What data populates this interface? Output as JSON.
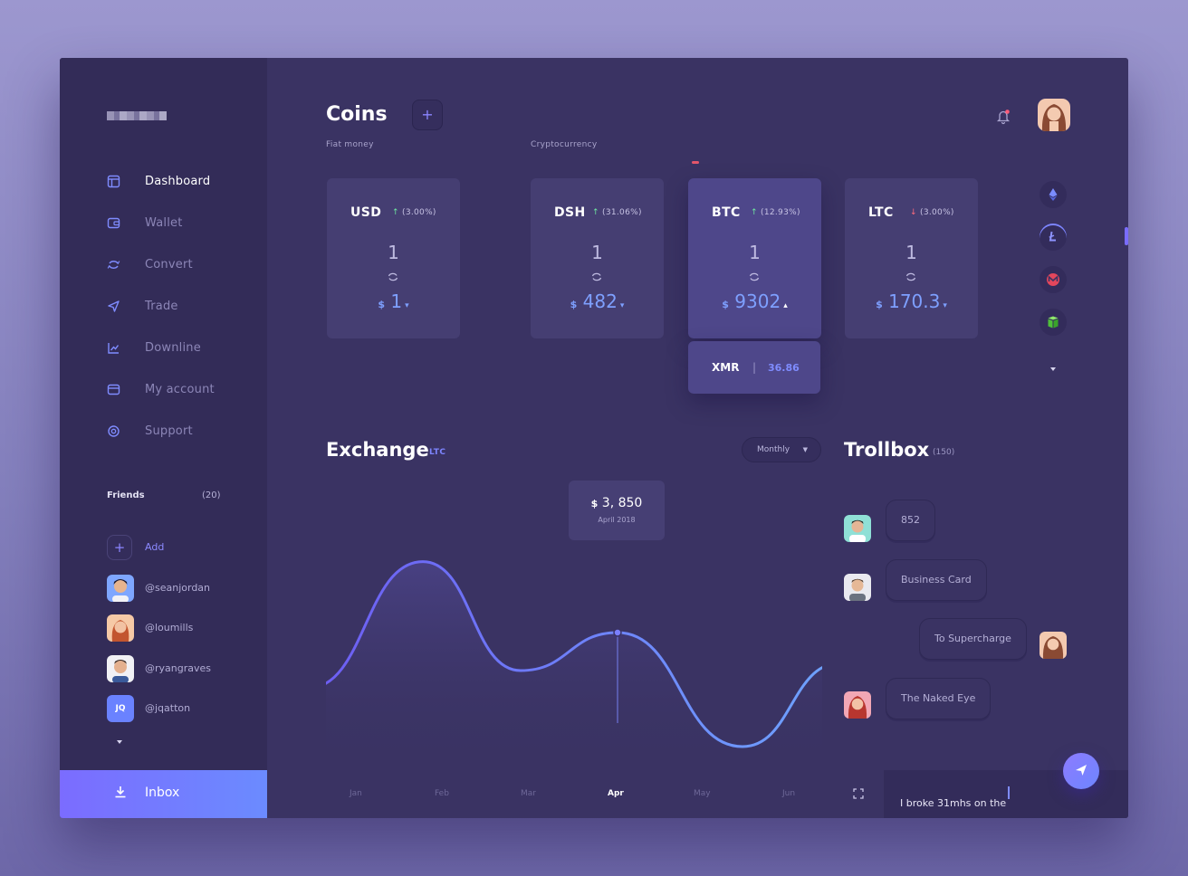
{
  "nav": [
    {
      "label": "Dashboard",
      "icon": "dashboard-icon"
    },
    {
      "label": "Wallet",
      "icon": "wallet-icon"
    },
    {
      "label": "Convert",
      "icon": "convert-icon"
    },
    {
      "label": "Trade",
      "icon": "trade-icon"
    },
    {
      "label": "Downline",
      "icon": "downline-icon"
    },
    {
      "label": "My account",
      "icon": "account-icon"
    },
    {
      "label": "Support",
      "icon": "support-icon"
    }
  ],
  "friends": {
    "heading": "Friends",
    "count": "(20)",
    "add_label": "Add",
    "list": [
      {
        "name": "@seanjordan"
      },
      {
        "name": "@loumills"
      },
      {
        "name": "@ryangraves"
      },
      {
        "name": "@jqatton",
        "initials": "JQ"
      }
    ]
  },
  "inbox": {
    "label": "Inbox"
  },
  "coins": {
    "title": "Coins",
    "add_label": "+",
    "fiat_label": "Fiat money",
    "crypto_label": "Cryptocurrency",
    "cards": [
      {
        "symbol": "USD",
        "change": "(3.00%)",
        "direction": "up",
        "amount": "1",
        "currency": "$",
        "price": "1",
        "caret": "▾"
      },
      {
        "symbol": "DSH",
        "change": "(31.06%)",
        "direction": "up",
        "amount": "1",
        "currency": "$",
        "price": "482",
        "caret": "▾"
      },
      {
        "symbol": "BTC",
        "change": "(12.93%)",
        "direction": "up",
        "amount": "1",
        "currency": "$",
        "price": "9302",
        "caret": "▴",
        "highlighted": true
      },
      {
        "symbol": "LTC",
        "change": "(3.00%)",
        "direction": "down",
        "amount": "1",
        "currency": "$",
        "price": "170.3",
        "caret": "▾"
      }
    ],
    "xmr": {
      "symbol": "XMR",
      "separator": "|",
      "value": "36.86"
    },
    "rail": [
      "ethereum-icon",
      "litecoin-icon",
      "monero-icon",
      "neo-icon"
    ]
  },
  "exchange": {
    "title": "Exchange",
    "tag": "LTC",
    "period": "Monthly",
    "tooltip": {
      "currency": "$",
      "value": "3, 850",
      "date": "April 2018"
    },
    "months": [
      "Jan",
      "Feb",
      "Mar",
      "Apr",
      "May",
      "Jun"
    ],
    "active_month": "Apr"
  },
  "chart_data": {
    "type": "line",
    "x": [
      "Jan",
      "Feb",
      "Mar",
      "Apr",
      "May",
      "Jun"
    ],
    "series": [
      {
        "values": [
          0.28,
          0.78,
          0.35,
          0.5,
          0.05,
          0.38
        ]
      }
    ],
    "highlight": {
      "x": "Apr",
      "label": "$ 3, 850"
    },
    "colors": {
      "start": "#6d5cf2",
      "end": "#6ea4ff"
    },
    "grid": false
  },
  "trollbox": {
    "title": "Trollbox",
    "count": "(150)",
    "messages": [
      {
        "text": "852",
        "side": "left"
      },
      {
        "text": "Business Card",
        "side": "left"
      },
      {
        "text": "To Supercharge",
        "side": "right"
      },
      {
        "text": "The Naked Eye",
        "side": "left"
      }
    ],
    "input_value": "I broke 31mhs on the"
  },
  "colors": {
    "accent": "#7a6cff",
    "price": "#7ea0ff",
    "up": "#6ee7a0",
    "down": "#ff6b7d",
    "background": "#3a3363",
    "sidebar": "#332c58"
  }
}
